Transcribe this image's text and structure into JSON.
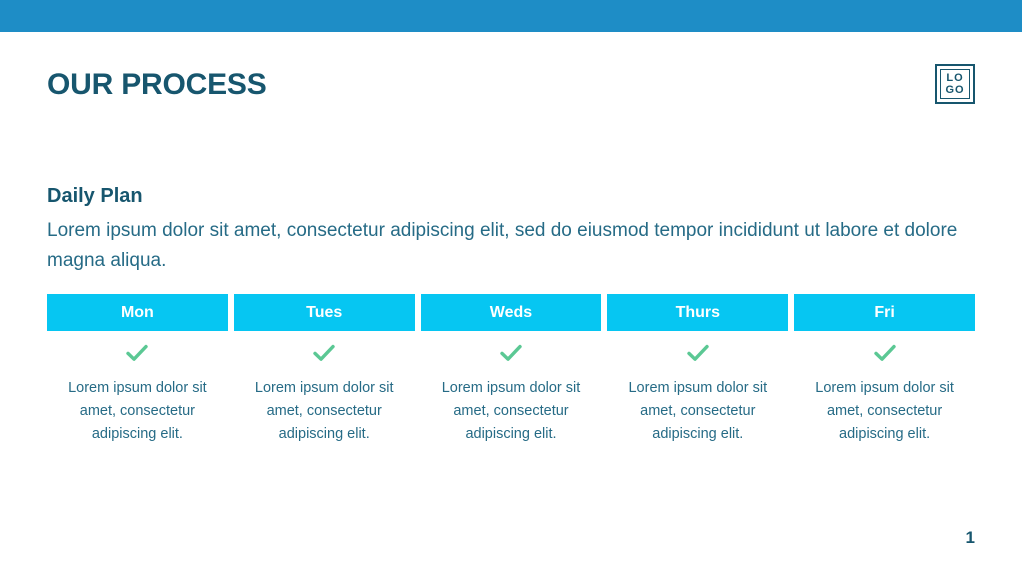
{
  "theme": {
    "top_bar_color": "#1E8DC6",
    "accent_cyan": "#06C6F2",
    "heading_color": "#17566E",
    "body_color": "#266B86",
    "check_color": "#5BC894",
    "background": "#FFFFFF"
  },
  "header": {
    "title": "OUR PROCESS",
    "logo": {
      "line1": "LO",
      "line2": "GO"
    }
  },
  "section": {
    "title": "Daily Plan",
    "body": "Lorem ipsum dolor sit amet, consectetur adipiscing elit, sed do eiusmod tempor incididunt ut labore et dolore magna aliqua."
  },
  "columns": [
    {
      "day": "Mon",
      "icon": "check-icon",
      "text": "Lorem ipsum dolor sit amet, consectetur adipiscing elit."
    },
    {
      "day": "Tues",
      "icon": "check-icon",
      "text": "Lorem ipsum dolor sit amet, consectetur adipiscing elit."
    },
    {
      "day": "Weds",
      "icon": "check-icon",
      "text": "Lorem ipsum dolor sit amet, consectetur adipiscing elit."
    },
    {
      "day": "Thurs",
      "icon": "check-icon",
      "text": "Lorem ipsum dolor sit amet, consectetur adipiscing elit."
    },
    {
      "day": "Fri",
      "icon": "check-icon",
      "text": "Lorem ipsum dolor sit amet, consectetur adipiscing elit."
    }
  ],
  "footer": {
    "page_number": "1"
  }
}
